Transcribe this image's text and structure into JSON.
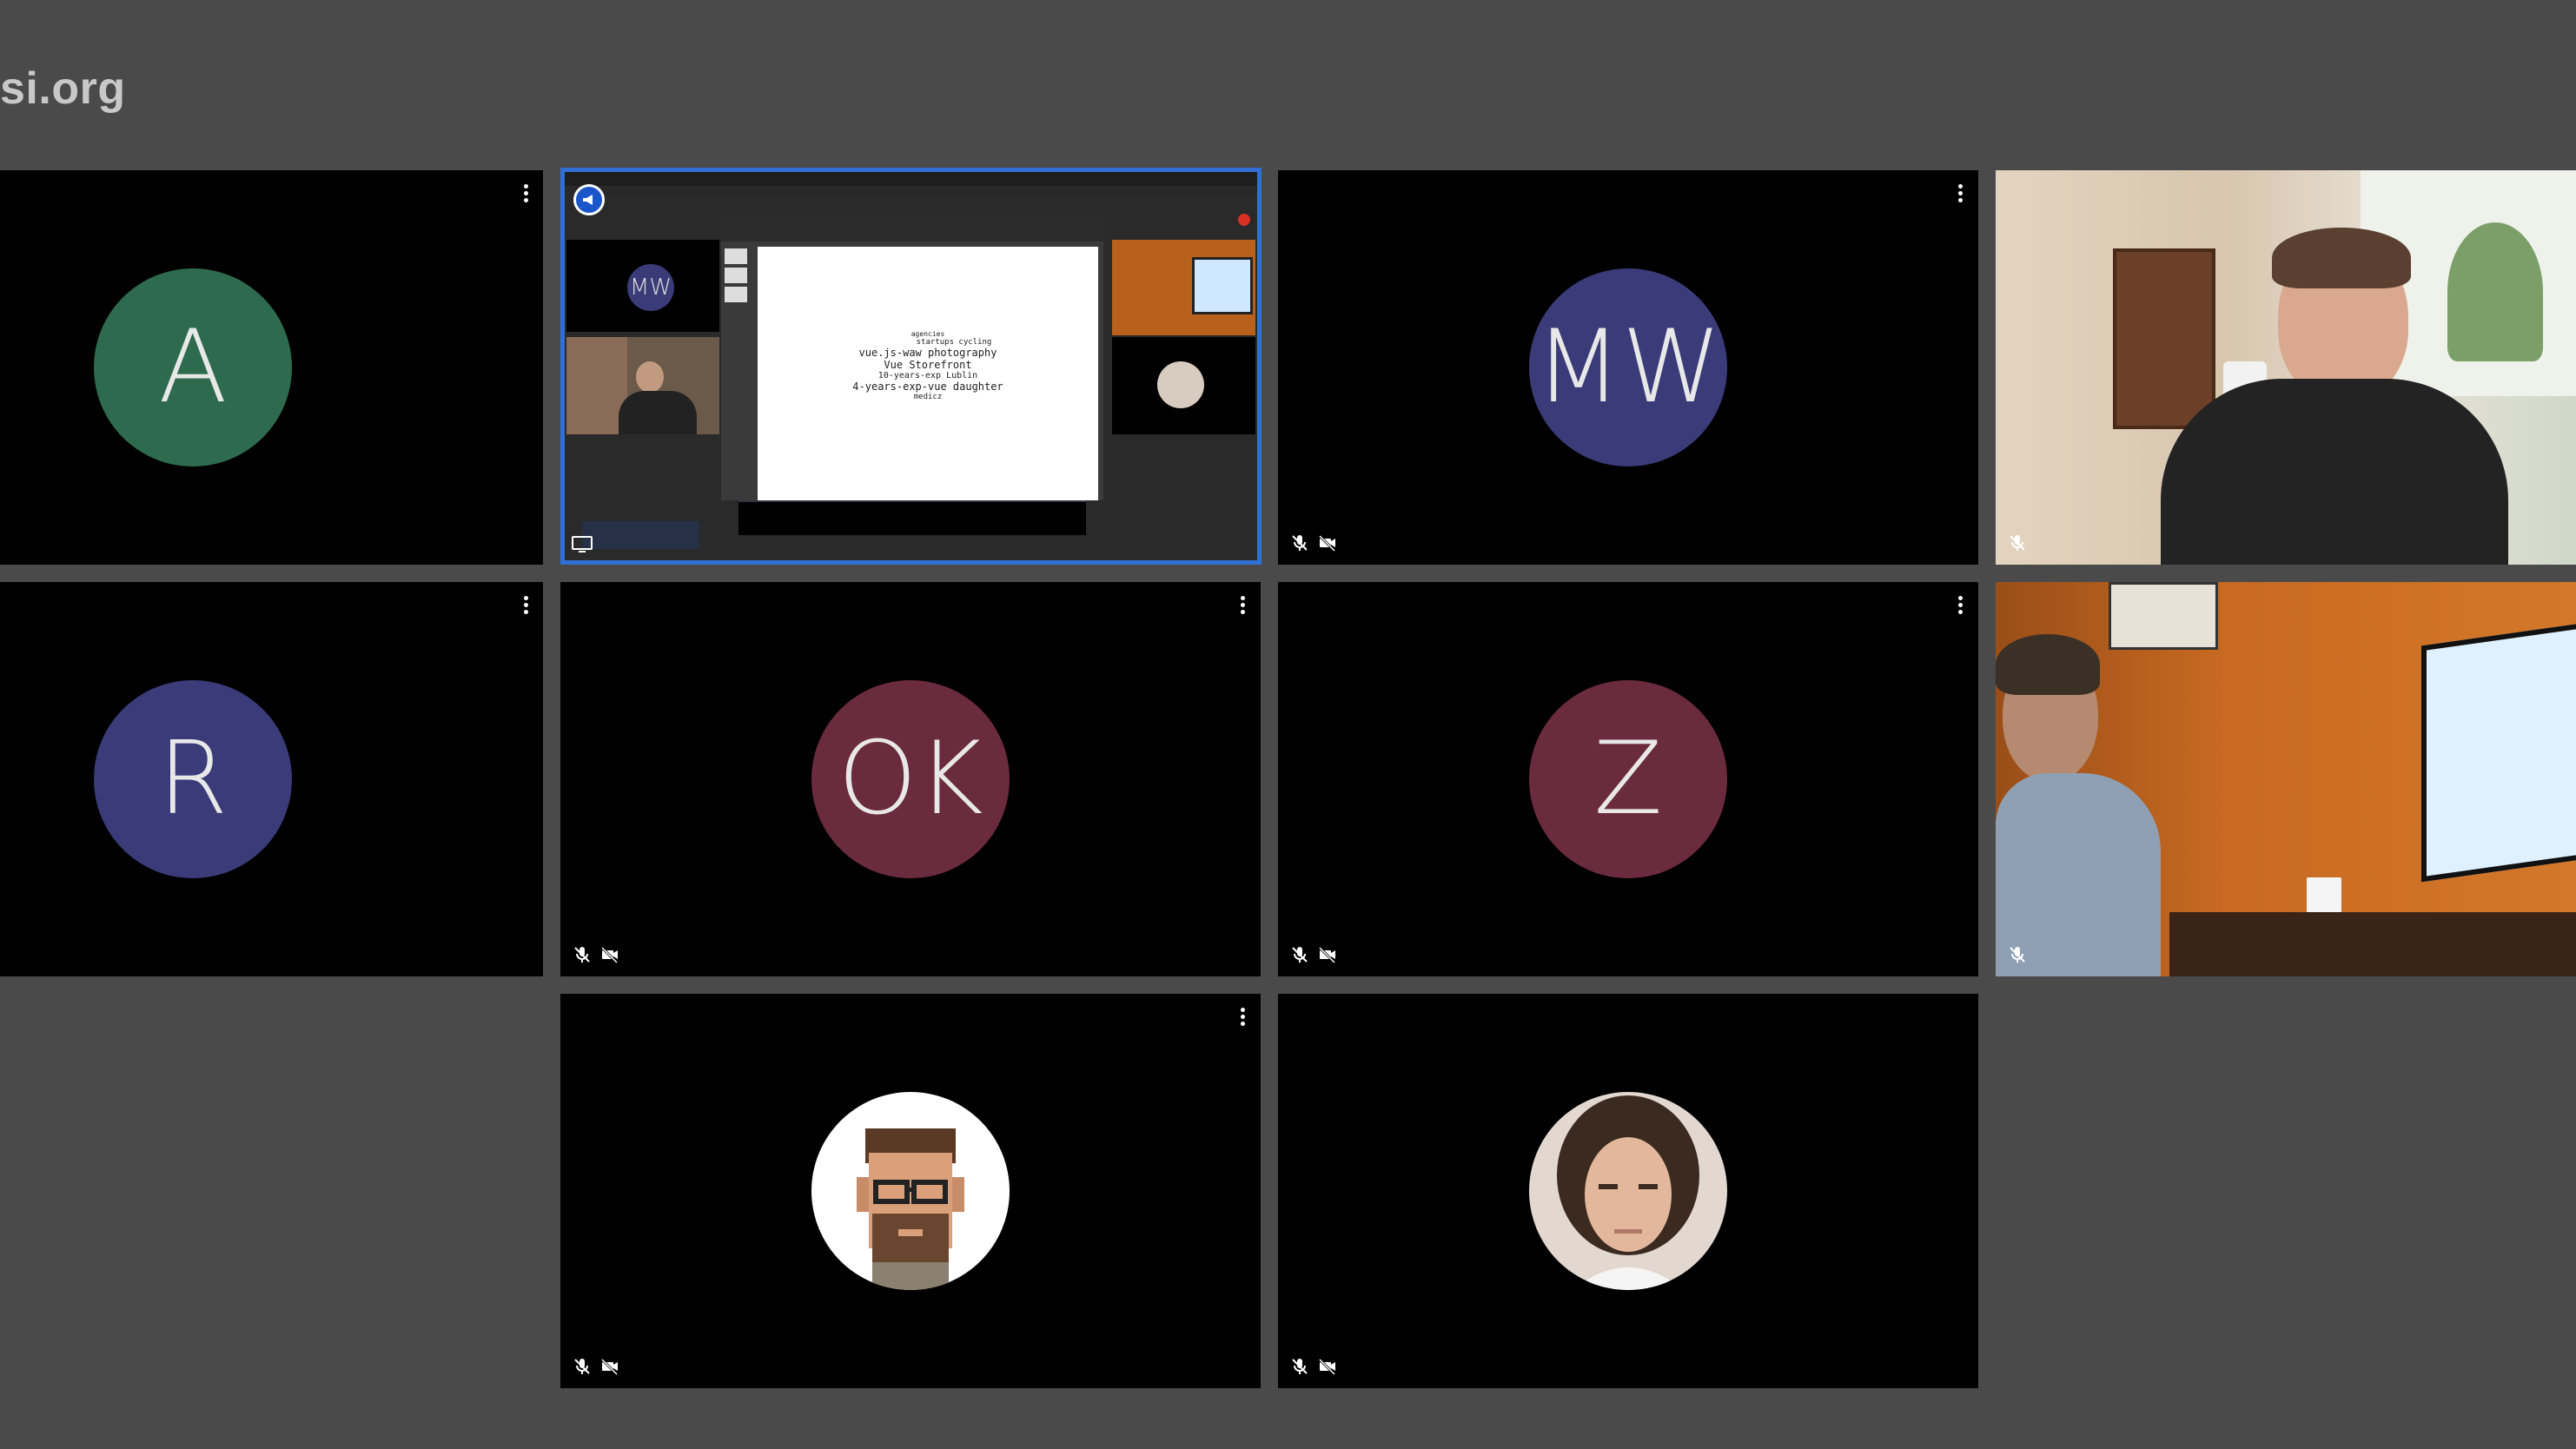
{
  "header": {
    "org_text": "si.org"
  },
  "participants": [
    {
      "initials": "A",
      "color": "#2e6b4e"
    },
    {
      "type": "screen-share",
      "label": "presentation"
    },
    {
      "initials": "MW",
      "color": "#3b3b7a"
    },
    {
      "type": "camera",
      "label": "man with headset"
    },
    {
      "initials": "R",
      "color": "#3b3b7a"
    },
    {
      "initials": "OK",
      "color": "#6b2b3e"
    },
    {
      "initials": "Z",
      "color": "#6b2b3e"
    },
    {
      "type": "camera",
      "label": "man at monitor"
    },
    {
      "type": "image-avatar",
      "label": "pixel avatar"
    },
    {
      "type": "image-avatar",
      "label": "photo avatar"
    }
  ],
  "share": {
    "slide_words": [
      "agencies",
      "startups cycling",
      "vue.js-waw photography",
      "Vue Storefront",
      "10-years-exp Lublin",
      "4-years-exp-vue daughter",
      "medicz"
    ],
    "mini_initials": "MW"
  },
  "colors": {
    "active_border": "#2f6fd6",
    "background": "#4a4a4a",
    "tile": "#000000"
  }
}
